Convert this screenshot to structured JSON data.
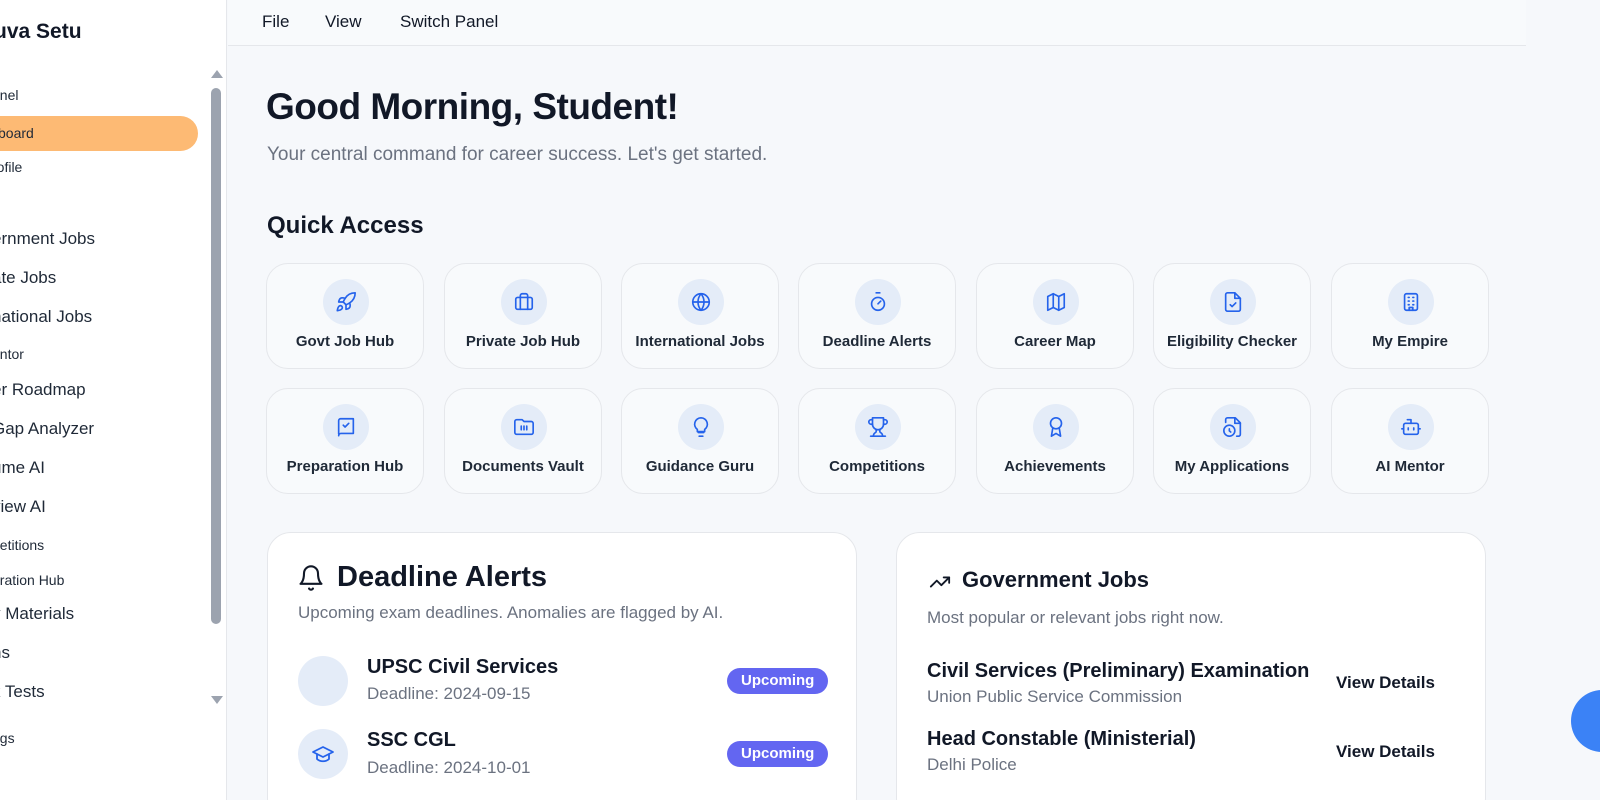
{
  "sidebar": {
    "brand": "uva Setu",
    "items": [
      {
        "label": "anel",
        "size": "small",
        "active": false
      },
      {
        "label": "board",
        "size": "small",
        "active": true
      },
      {
        "label": "rofile",
        "size": "small",
        "active": false
      },
      {
        "label": "ernment Jobs",
        "size": "large",
        "active": false
      },
      {
        "label": "ate Jobs",
        "size": "large",
        "active": false
      },
      {
        "label": "national Jobs",
        "size": "large",
        "active": false
      },
      {
        "label": "entor",
        "size": "small",
        "active": false
      },
      {
        "label": "er Roadmap",
        "size": "large",
        "active": false
      },
      {
        "label": "Gap Analyzer",
        "size": "large",
        "active": false
      },
      {
        "label": "ume AI",
        "size": "large",
        "active": false
      },
      {
        "label": "view AI",
        "size": "large",
        "active": false
      },
      {
        "label": "petitions",
        "size": "small",
        "active": false
      },
      {
        "label": "aration Hub",
        "size": "small",
        "active": false
      },
      {
        "label": "y Materials",
        "size": "large",
        "active": false
      },
      {
        "label": "ns",
        "size": "large",
        "active": false
      },
      {
        "label": "k Tests",
        "size": "large",
        "active": false
      },
      {
        "label": "ngs",
        "size": "small",
        "active": false
      }
    ]
  },
  "menubar": {
    "file": "File",
    "view": "View",
    "switch_panel": "Switch Panel"
  },
  "main": {
    "greeting": "Good Morning, Student!",
    "subtitle": "Your central command for career success. Let's get started.",
    "quick_access_title": "Quick Access",
    "tiles": [
      {
        "label": "Govt Job Hub",
        "icon": "rocket-icon"
      },
      {
        "label": "Private Job Hub",
        "icon": "briefcase-icon"
      },
      {
        "label": "International Jobs",
        "icon": "globe-icon"
      },
      {
        "label": "Deadline Alerts",
        "icon": "stopwatch-icon"
      },
      {
        "label": "Career Map",
        "icon": "map-icon"
      },
      {
        "label": "Eligibility Checker",
        "icon": "file-check-icon"
      },
      {
        "label": "My Empire",
        "icon": "building-icon"
      },
      {
        "label": "Preparation Hub",
        "icon": "book-check-icon"
      },
      {
        "label": "Documents Vault",
        "icon": "folder-icon"
      },
      {
        "label": "Guidance Guru",
        "icon": "lightbulb-icon"
      },
      {
        "label": "Competitions",
        "icon": "trophy-icon"
      },
      {
        "label": "Achievements",
        "icon": "award-icon"
      },
      {
        "label": "My Applications",
        "icon": "file-clock-icon"
      },
      {
        "label": "AI Mentor",
        "icon": "bot-icon"
      }
    ]
  },
  "deadline_card": {
    "title": "Deadline Alerts",
    "description": "Upcoming exam deadlines. Anomalies are flagged by AI.",
    "items": [
      {
        "name": "UPSC Civil Services",
        "deadline": "Deadline: 2024-09-15",
        "status": "Upcoming",
        "icon": ""
      },
      {
        "name": "SSC CGL",
        "deadline": "Deadline: 2024-10-01",
        "status": "Upcoming",
        "icon": "graduation-cap-icon"
      }
    ]
  },
  "gov_card": {
    "title": "Government Jobs",
    "description": "Most popular or relevant jobs right now.",
    "jobs": [
      {
        "name": "Civil Services (Preliminary) Examination",
        "org": "Union Public Service Commission",
        "action": "View Details"
      },
      {
        "name": "Head Constable (Ministerial)",
        "org": "Delhi Police",
        "action": "View Details"
      }
    ]
  },
  "colors": {
    "accent": "#2563eb",
    "active_nav": "#fdba74",
    "badge": "#6366f1",
    "icon_bg": "#e4ecf8"
  }
}
